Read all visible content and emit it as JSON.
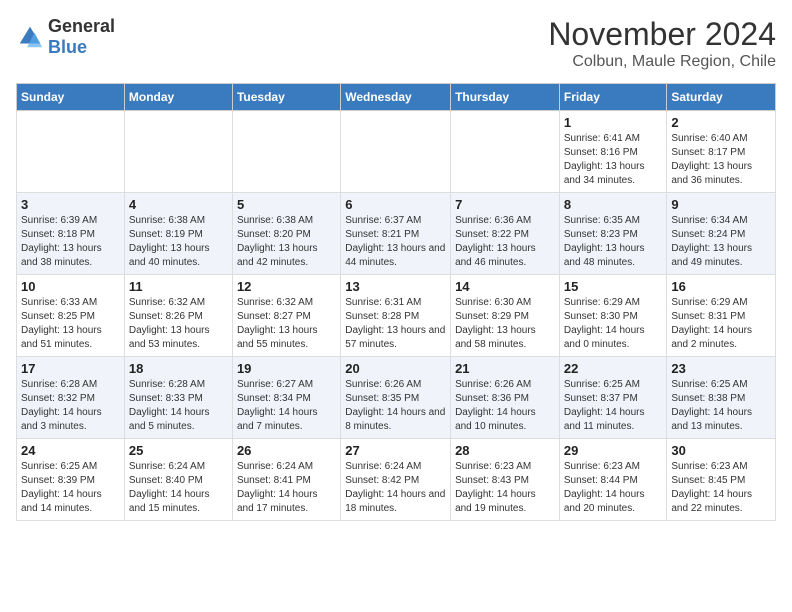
{
  "header": {
    "logo_general": "General",
    "logo_blue": "Blue",
    "title": "November 2024",
    "subtitle": "Colbun, Maule Region, Chile"
  },
  "days_of_week": [
    "Sunday",
    "Monday",
    "Tuesday",
    "Wednesday",
    "Thursday",
    "Friday",
    "Saturday"
  ],
  "weeks": [
    [
      {
        "day": "",
        "sunrise": "",
        "sunset": "",
        "daylight": ""
      },
      {
        "day": "",
        "sunrise": "",
        "sunset": "",
        "daylight": ""
      },
      {
        "day": "",
        "sunrise": "",
        "sunset": "",
        "daylight": ""
      },
      {
        "day": "",
        "sunrise": "",
        "sunset": "",
        "daylight": ""
      },
      {
        "day": "",
        "sunrise": "",
        "sunset": "",
        "daylight": ""
      },
      {
        "day": "1",
        "sunrise": "Sunrise: 6:41 AM",
        "sunset": "Sunset: 8:16 PM",
        "daylight": "Daylight: 13 hours and 34 minutes."
      },
      {
        "day": "2",
        "sunrise": "Sunrise: 6:40 AM",
        "sunset": "Sunset: 8:17 PM",
        "daylight": "Daylight: 13 hours and 36 minutes."
      }
    ],
    [
      {
        "day": "3",
        "sunrise": "Sunrise: 6:39 AM",
        "sunset": "Sunset: 8:18 PM",
        "daylight": "Daylight: 13 hours and 38 minutes."
      },
      {
        "day": "4",
        "sunrise": "Sunrise: 6:38 AM",
        "sunset": "Sunset: 8:19 PM",
        "daylight": "Daylight: 13 hours and 40 minutes."
      },
      {
        "day": "5",
        "sunrise": "Sunrise: 6:38 AM",
        "sunset": "Sunset: 8:20 PM",
        "daylight": "Daylight: 13 hours and 42 minutes."
      },
      {
        "day": "6",
        "sunrise": "Sunrise: 6:37 AM",
        "sunset": "Sunset: 8:21 PM",
        "daylight": "Daylight: 13 hours and 44 minutes."
      },
      {
        "day": "7",
        "sunrise": "Sunrise: 6:36 AM",
        "sunset": "Sunset: 8:22 PM",
        "daylight": "Daylight: 13 hours and 46 minutes."
      },
      {
        "day": "8",
        "sunrise": "Sunrise: 6:35 AM",
        "sunset": "Sunset: 8:23 PM",
        "daylight": "Daylight: 13 hours and 48 minutes."
      },
      {
        "day": "9",
        "sunrise": "Sunrise: 6:34 AM",
        "sunset": "Sunset: 8:24 PM",
        "daylight": "Daylight: 13 hours and 49 minutes."
      }
    ],
    [
      {
        "day": "10",
        "sunrise": "Sunrise: 6:33 AM",
        "sunset": "Sunset: 8:25 PM",
        "daylight": "Daylight: 13 hours and 51 minutes."
      },
      {
        "day": "11",
        "sunrise": "Sunrise: 6:32 AM",
        "sunset": "Sunset: 8:26 PM",
        "daylight": "Daylight: 13 hours and 53 minutes."
      },
      {
        "day": "12",
        "sunrise": "Sunrise: 6:32 AM",
        "sunset": "Sunset: 8:27 PM",
        "daylight": "Daylight: 13 hours and 55 minutes."
      },
      {
        "day": "13",
        "sunrise": "Sunrise: 6:31 AM",
        "sunset": "Sunset: 8:28 PM",
        "daylight": "Daylight: 13 hours and 57 minutes."
      },
      {
        "day": "14",
        "sunrise": "Sunrise: 6:30 AM",
        "sunset": "Sunset: 8:29 PM",
        "daylight": "Daylight: 13 hours and 58 minutes."
      },
      {
        "day": "15",
        "sunrise": "Sunrise: 6:29 AM",
        "sunset": "Sunset: 8:30 PM",
        "daylight": "Daylight: 14 hours and 0 minutes."
      },
      {
        "day": "16",
        "sunrise": "Sunrise: 6:29 AM",
        "sunset": "Sunset: 8:31 PM",
        "daylight": "Daylight: 14 hours and 2 minutes."
      }
    ],
    [
      {
        "day": "17",
        "sunrise": "Sunrise: 6:28 AM",
        "sunset": "Sunset: 8:32 PM",
        "daylight": "Daylight: 14 hours and 3 minutes."
      },
      {
        "day": "18",
        "sunrise": "Sunrise: 6:28 AM",
        "sunset": "Sunset: 8:33 PM",
        "daylight": "Daylight: 14 hours and 5 minutes."
      },
      {
        "day": "19",
        "sunrise": "Sunrise: 6:27 AM",
        "sunset": "Sunset: 8:34 PM",
        "daylight": "Daylight: 14 hours and 7 minutes."
      },
      {
        "day": "20",
        "sunrise": "Sunrise: 6:26 AM",
        "sunset": "Sunset: 8:35 PM",
        "daylight": "Daylight: 14 hours and 8 minutes."
      },
      {
        "day": "21",
        "sunrise": "Sunrise: 6:26 AM",
        "sunset": "Sunset: 8:36 PM",
        "daylight": "Daylight: 14 hours and 10 minutes."
      },
      {
        "day": "22",
        "sunrise": "Sunrise: 6:25 AM",
        "sunset": "Sunset: 8:37 PM",
        "daylight": "Daylight: 14 hours and 11 minutes."
      },
      {
        "day": "23",
        "sunrise": "Sunrise: 6:25 AM",
        "sunset": "Sunset: 8:38 PM",
        "daylight": "Daylight: 14 hours and 13 minutes."
      }
    ],
    [
      {
        "day": "24",
        "sunrise": "Sunrise: 6:25 AM",
        "sunset": "Sunset: 8:39 PM",
        "daylight": "Daylight: 14 hours and 14 minutes."
      },
      {
        "day": "25",
        "sunrise": "Sunrise: 6:24 AM",
        "sunset": "Sunset: 8:40 PM",
        "daylight": "Daylight: 14 hours and 15 minutes."
      },
      {
        "day": "26",
        "sunrise": "Sunrise: 6:24 AM",
        "sunset": "Sunset: 8:41 PM",
        "daylight": "Daylight: 14 hours and 17 minutes."
      },
      {
        "day": "27",
        "sunrise": "Sunrise: 6:24 AM",
        "sunset": "Sunset: 8:42 PM",
        "daylight": "Daylight: 14 hours and 18 minutes."
      },
      {
        "day": "28",
        "sunrise": "Sunrise: 6:23 AM",
        "sunset": "Sunset: 8:43 PM",
        "daylight": "Daylight: 14 hours and 19 minutes."
      },
      {
        "day": "29",
        "sunrise": "Sunrise: 6:23 AM",
        "sunset": "Sunset: 8:44 PM",
        "daylight": "Daylight: 14 hours and 20 minutes."
      },
      {
        "day": "30",
        "sunrise": "Sunrise: 6:23 AM",
        "sunset": "Sunset: 8:45 PM",
        "daylight": "Daylight: 14 hours and 22 minutes."
      }
    ]
  ]
}
